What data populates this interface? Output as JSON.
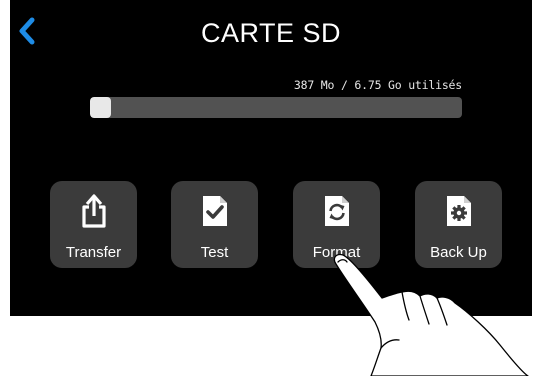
{
  "header": {
    "title": "CARTE SD",
    "back_icon": "chevron-left-icon",
    "accent_color": "#1e8ce6"
  },
  "storage": {
    "usage_text": "387 Mo / 6.75 Go utilisés",
    "used_fraction": 0.056
  },
  "actions": [
    {
      "label": "Transfer",
      "icon": "share-upload-icon"
    },
    {
      "label": "Test",
      "icon": "checkmark-document-icon"
    },
    {
      "label": "Format",
      "icon": "refresh-document-icon"
    },
    {
      "label": "Back Up",
      "icon": "gear-document-icon"
    }
  ],
  "colors": {
    "screen_background": "#000000",
    "button_background": "#3b3b3b",
    "progress_track": "#525252",
    "progress_fill": "#e8e8e8"
  }
}
